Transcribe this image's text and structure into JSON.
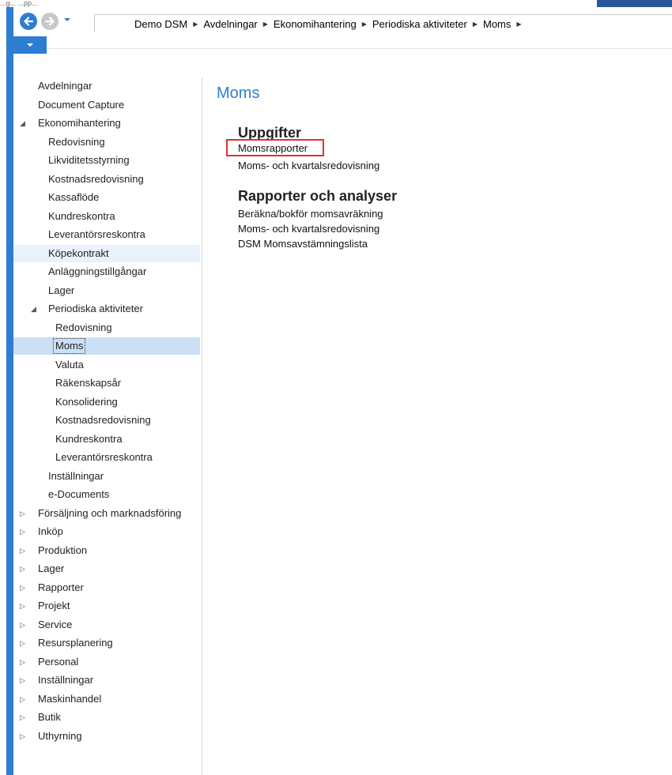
{
  "colors": {
    "accent": "#2d7dd2",
    "selected_background": "#cce0f5",
    "hover_background": "#e9f1fa",
    "highlight_border": "#e03030"
  },
  "window": {
    "title_fragment": "...g... ...pp..."
  },
  "navigation": {
    "back_icon": "arrow-left-icon",
    "forward_icon": "arrow-right-icon",
    "history_icon": "chevron-down-icon",
    "menu_icon": "chevron-down-icon",
    "breadcrumb": [
      "Demo DSM",
      "Avdelningar",
      "Ekonomihantering",
      "Periodiska aktiviteter",
      "Moms"
    ]
  },
  "sidebar": {
    "items": [
      {
        "label": "Avdelningar",
        "level": 0,
        "expander": "none"
      },
      {
        "label": "Document Capture",
        "level": 0,
        "expander": "none"
      },
      {
        "label": "Ekonomihantering",
        "level": 0,
        "expander": "expanded"
      },
      {
        "label": "Redovisning",
        "level": 1,
        "expander": "none"
      },
      {
        "label": "Likviditetsstyrning",
        "level": 1,
        "expander": "none"
      },
      {
        "label": "Kostnadsredovisning",
        "level": 1,
        "expander": "none"
      },
      {
        "label": "Kassaflöde",
        "level": 1,
        "expander": "none"
      },
      {
        "label": "Kundreskontra",
        "level": 1,
        "expander": "none"
      },
      {
        "label": "Leverantörsreskontra",
        "level": 1,
        "expander": "none"
      },
      {
        "label": "Köpekontrakt",
        "level": 1,
        "expander": "none",
        "state": "hover"
      },
      {
        "label": "Anläggningstillgångar",
        "level": 1,
        "expander": "none"
      },
      {
        "label": "Lager",
        "level": 1,
        "expander": "none"
      },
      {
        "label": "Periodiska aktiviteter",
        "level": 1,
        "expander": "expanded"
      },
      {
        "label": "Redovisning",
        "level": 2,
        "expander": "none"
      },
      {
        "label": "Moms",
        "level": 2,
        "expander": "none",
        "state": "selected"
      },
      {
        "label": "Valuta",
        "level": 2,
        "expander": "none"
      },
      {
        "label": "Räkenskapsår",
        "level": 2,
        "expander": "none"
      },
      {
        "label": "Konsolidering",
        "level": 2,
        "expander": "none"
      },
      {
        "label": "Kostnadsredovisning",
        "level": 2,
        "expander": "none"
      },
      {
        "label": "Kundreskontra",
        "level": 2,
        "expander": "none"
      },
      {
        "label": "Leverantörsreskontra",
        "level": 2,
        "expander": "none"
      },
      {
        "label": "Inställningar",
        "level": 1,
        "expander": "none"
      },
      {
        "label": "e-Documents",
        "level": 1,
        "expander": "none"
      },
      {
        "label": "Försäljning och marknadsföring",
        "level": 0,
        "expander": "collapsed"
      },
      {
        "label": "Inköp",
        "level": 0,
        "expander": "collapsed"
      },
      {
        "label": "Produktion",
        "level": 0,
        "expander": "collapsed"
      },
      {
        "label": "Lager",
        "level": 0,
        "expander": "collapsed"
      },
      {
        "label": "Rapporter",
        "level": 0,
        "expander": "collapsed"
      },
      {
        "label": "Projekt",
        "level": 0,
        "expander": "collapsed"
      },
      {
        "label": "Service",
        "level": 0,
        "expander": "collapsed"
      },
      {
        "label": "Resursplanering",
        "level": 0,
        "expander": "collapsed"
      },
      {
        "label": "Personal",
        "level": 0,
        "expander": "collapsed"
      },
      {
        "label": "Inställningar",
        "level": 0,
        "expander": "collapsed"
      },
      {
        "label": "Maskinhandel",
        "level": 0,
        "expander": "collapsed"
      },
      {
        "label": "Butik",
        "level": 0,
        "expander": "collapsed"
      },
      {
        "label": "Uthyrning",
        "level": 0,
        "expander": "collapsed"
      }
    ]
  },
  "main": {
    "title": "Moms",
    "groups": [
      {
        "title": "Uppgifter",
        "items": [
          {
            "label": "Momsrapporter",
            "highlighted": true
          },
          {
            "label": "Moms- och kvartalsredovisning",
            "highlighted": false
          }
        ]
      },
      {
        "title": "Rapporter och analyser",
        "items": [
          {
            "label": "Beräkna/bokför momsavräkning",
            "highlighted": false
          },
          {
            "label": "Moms- och kvartalsredovisning",
            "highlighted": false
          },
          {
            "label": "DSM Momsavstämningslista",
            "highlighted": false
          }
        ]
      }
    ]
  }
}
